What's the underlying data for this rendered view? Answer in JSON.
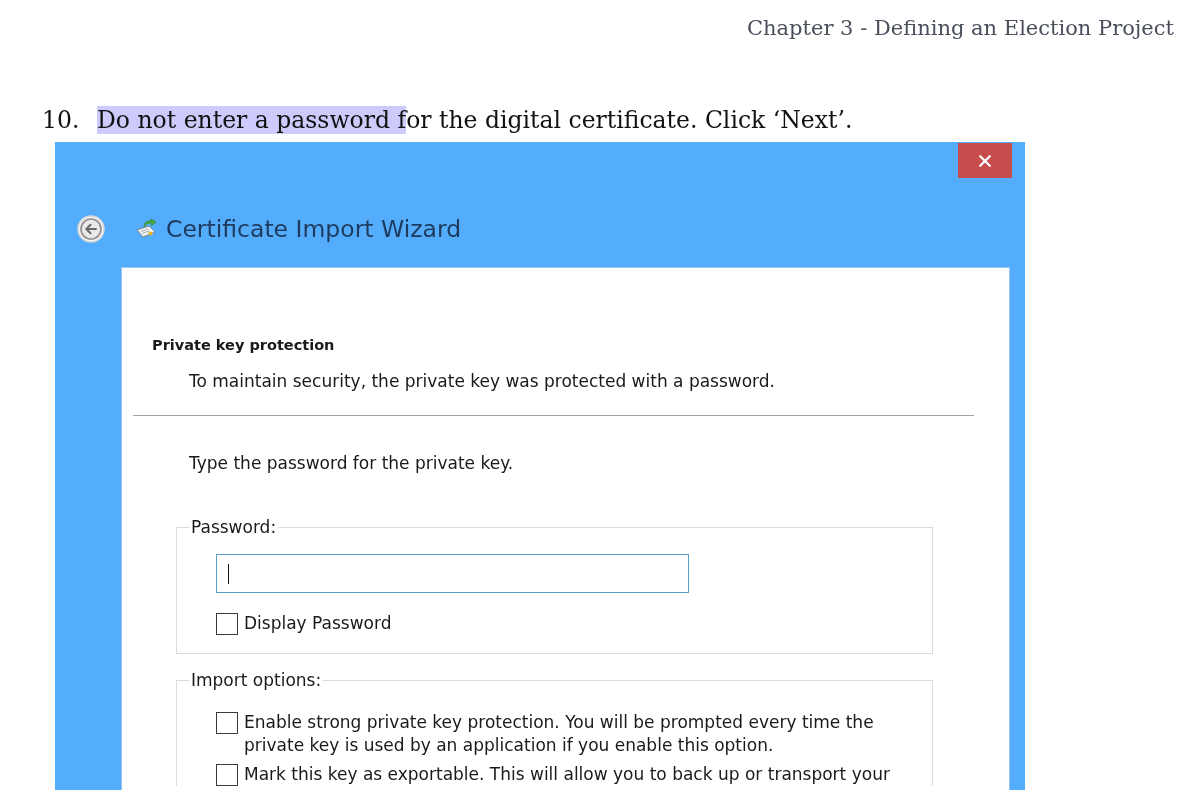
{
  "header": {
    "chapter_title": "Chapter 3 - Defining an Election Project"
  },
  "instruction": {
    "number": "10.",
    "segments": [
      {
        "text": "Do not enter a password f",
        "highlighted": true
      },
      {
        "text": "or the digital certificate. Click ‘Next’.",
        "highlighted": false
      }
    ]
  },
  "window": {
    "title": "Certificate Import Wizard",
    "section_title": "Private key protection",
    "section_description": "To maintain security, the private key was protected with a password.",
    "prompt": "Type the password for the private key.",
    "groups": [
      {
        "label": "Password:",
        "items": [
          {
            "kind": "password_field",
            "focused": true
          },
          {
            "kind": "checkbox",
            "label": "Display Password",
            "checked": false
          }
        ]
      },
      {
        "label": "Import options:",
        "items": [
          {
            "kind": "checkbox",
            "label": "Enable strong private key protection. You will be prompted every time the private key is used by an application if you enable this option.",
            "checked": false
          },
          {
            "kind": "checkbox",
            "label": "Mark this key as exportable. This will allow you to back up or transport your",
            "checked": false
          }
        ]
      }
    ]
  }
}
